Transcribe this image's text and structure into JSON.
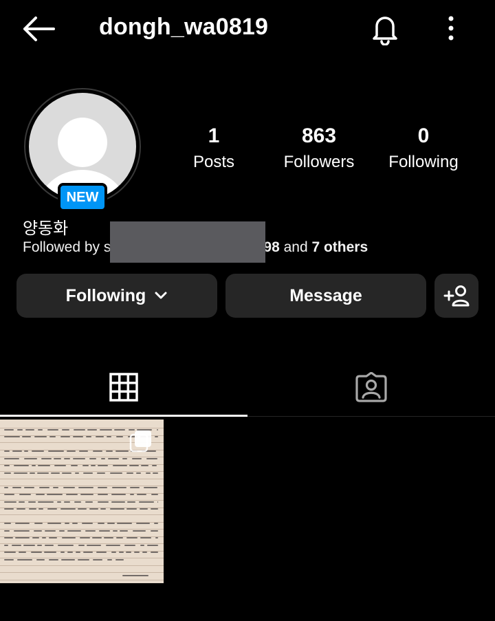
{
  "header": {
    "username": "dongh_wa0819",
    "back_icon": "back-arrow-icon",
    "bell_icon": "bell-icon",
    "more_icon": "more-vertical-icon"
  },
  "profile": {
    "avatar_icon": "default-avatar-icon",
    "badge": "NEW",
    "display_name": "양동화",
    "followed_by_prefix": "Followed by s",
    "followed_by_suffix": "98",
    "followed_by_and": " and ",
    "followed_by_others": "7 others"
  },
  "stats": [
    {
      "value": "1",
      "label": "Posts"
    },
    {
      "value": "863",
      "label": "Followers"
    },
    {
      "value": "0",
      "label": "Following"
    }
  ],
  "actions": {
    "following_label": "Following",
    "message_label": "Message",
    "add_person_icon": "add-person-icon"
  },
  "tabs": [
    {
      "icon": "grid-icon",
      "active": true
    },
    {
      "icon": "tagged-icon",
      "active": false
    }
  ],
  "posts": [
    {
      "type": "handwritten-letter-photo",
      "multiple": true
    }
  ],
  "colors": {
    "background": "#000000",
    "button": "#262626",
    "badge": "#0095f6",
    "redaction": "#5a5a5e"
  }
}
